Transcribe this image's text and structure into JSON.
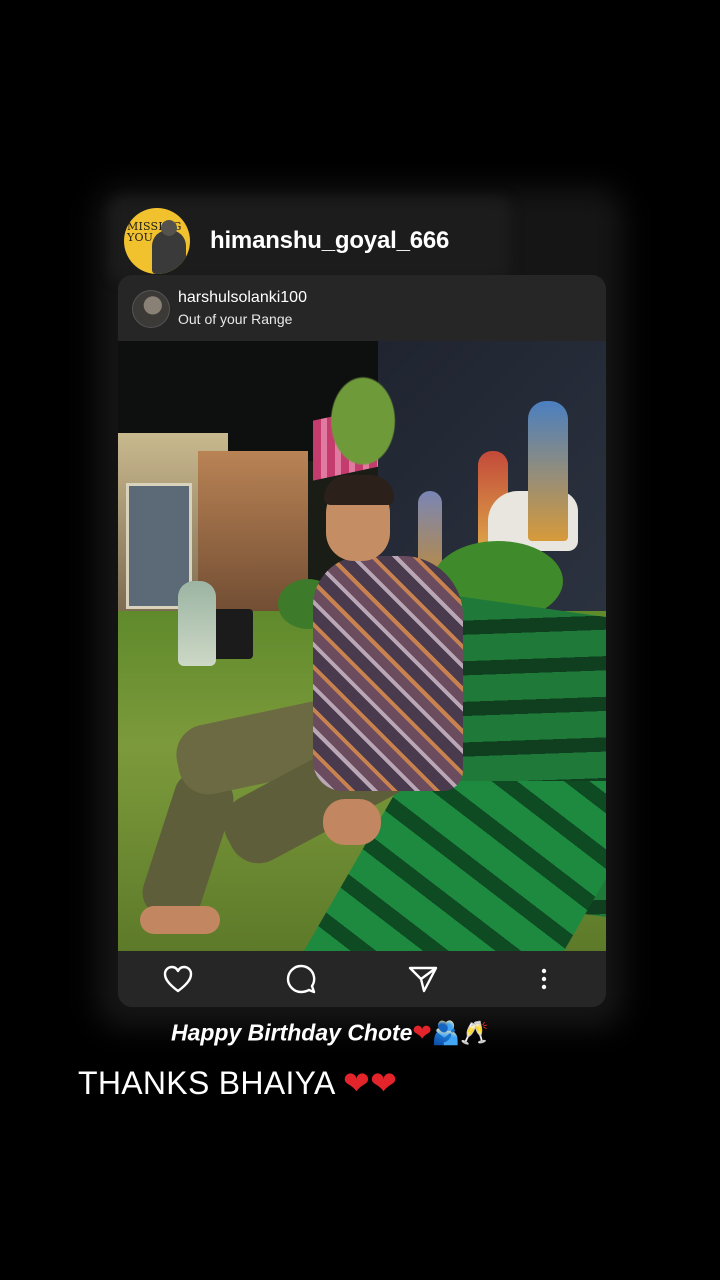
{
  "story": {
    "sharer_username": "himanshu_goyal_666",
    "sharer_avatar_text": "MISSING YOU"
  },
  "post": {
    "author_username": "harshulsolanki100",
    "author_subtitle": "Out of your Range",
    "actions": {
      "like_icon": "heart-outline-icon",
      "comment_icon": "speech-bubble-icon",
      "share_icon": "paper-plane-icon",
      "more_icon": "vertical-dots-icon"
    }
  },
  "caption": {
    "text": "Happy Birthday Chote",
    "emojis": "❤🫂🥂"
  },
  "reply": {
    "text": "THANKS BHAIYA",
    "emojis": "❤❤"
  },
  "colors": {
    "background": "#000000",
    "card": "#262626",
    "heart": "#e3242b"
  }
}
